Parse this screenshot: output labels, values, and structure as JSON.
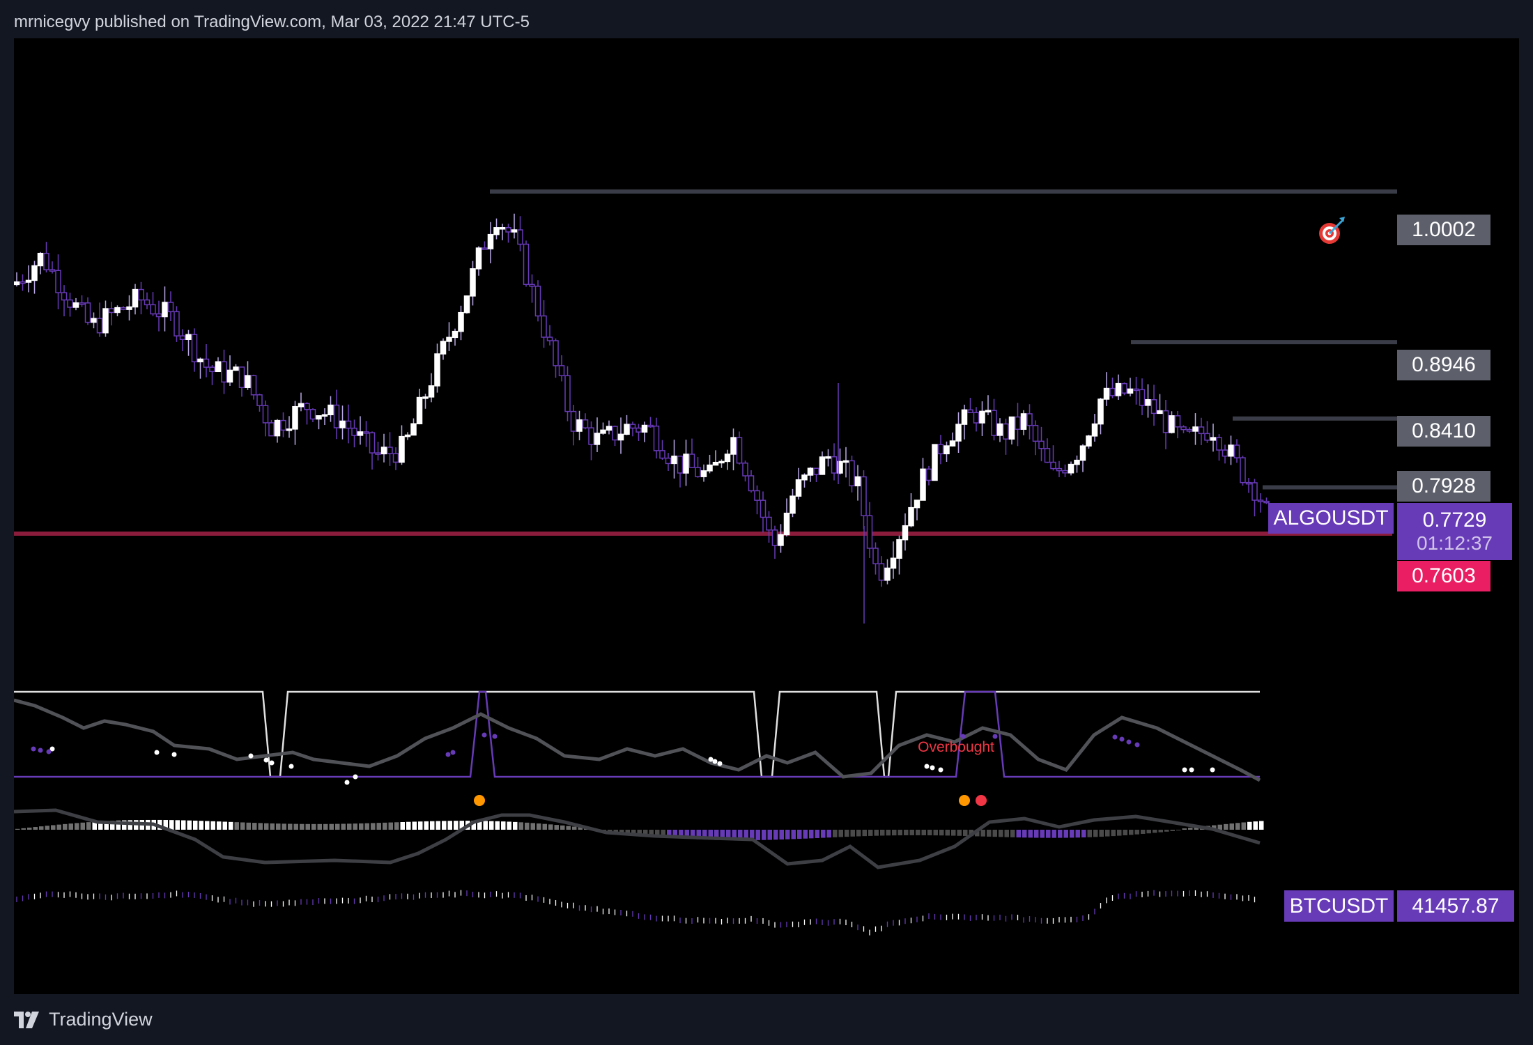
{
  "header": {
    "text": "mrnicegvy published on TradingView.com, Mar 03, 2022 21:47 UTC-5"
  },
  "levels": [
    {
      "price": "1.0002"
    },
    {
      "price": "0.8946"
    },
    {
      "price": "0.8410"
    },
    {
      "price": "0.7928"
    }
  ],
  "symbol": {
    "name": "ALGOUSDT",
    "price": "0.7729",
    "countdown": "01:12:37"
  },
  "support": {
    "price": "0.7603"
  },
  "oscillator": {
    "label": "Overbought"
  },
  "compare": {
    "name": "BTCUSDT",
    "price": "41457.87"
  },
  "footer": {
    "brand": "TradingView"
  },
  "colors": {
    "background": "#000000",
    "page": "#131722",
    "bull": "#ffffff",
    "bear": "#673ab7",
    "level_line": "#3a3d47",
    "level_tag": "#5d606b",
    "symbol_tag": "#673ab7",
    "support_line": "#8c1c3c",
    "support_tag": "#e91e63",
    "overbought_text": "#f23645",
    "dot_orange": "#ff9800",
    "dot_red": "#f23645"
  },
  "icons": {
    "target": "target-icon",
    "logo": "tradingview-logo-icon"
  }
}
